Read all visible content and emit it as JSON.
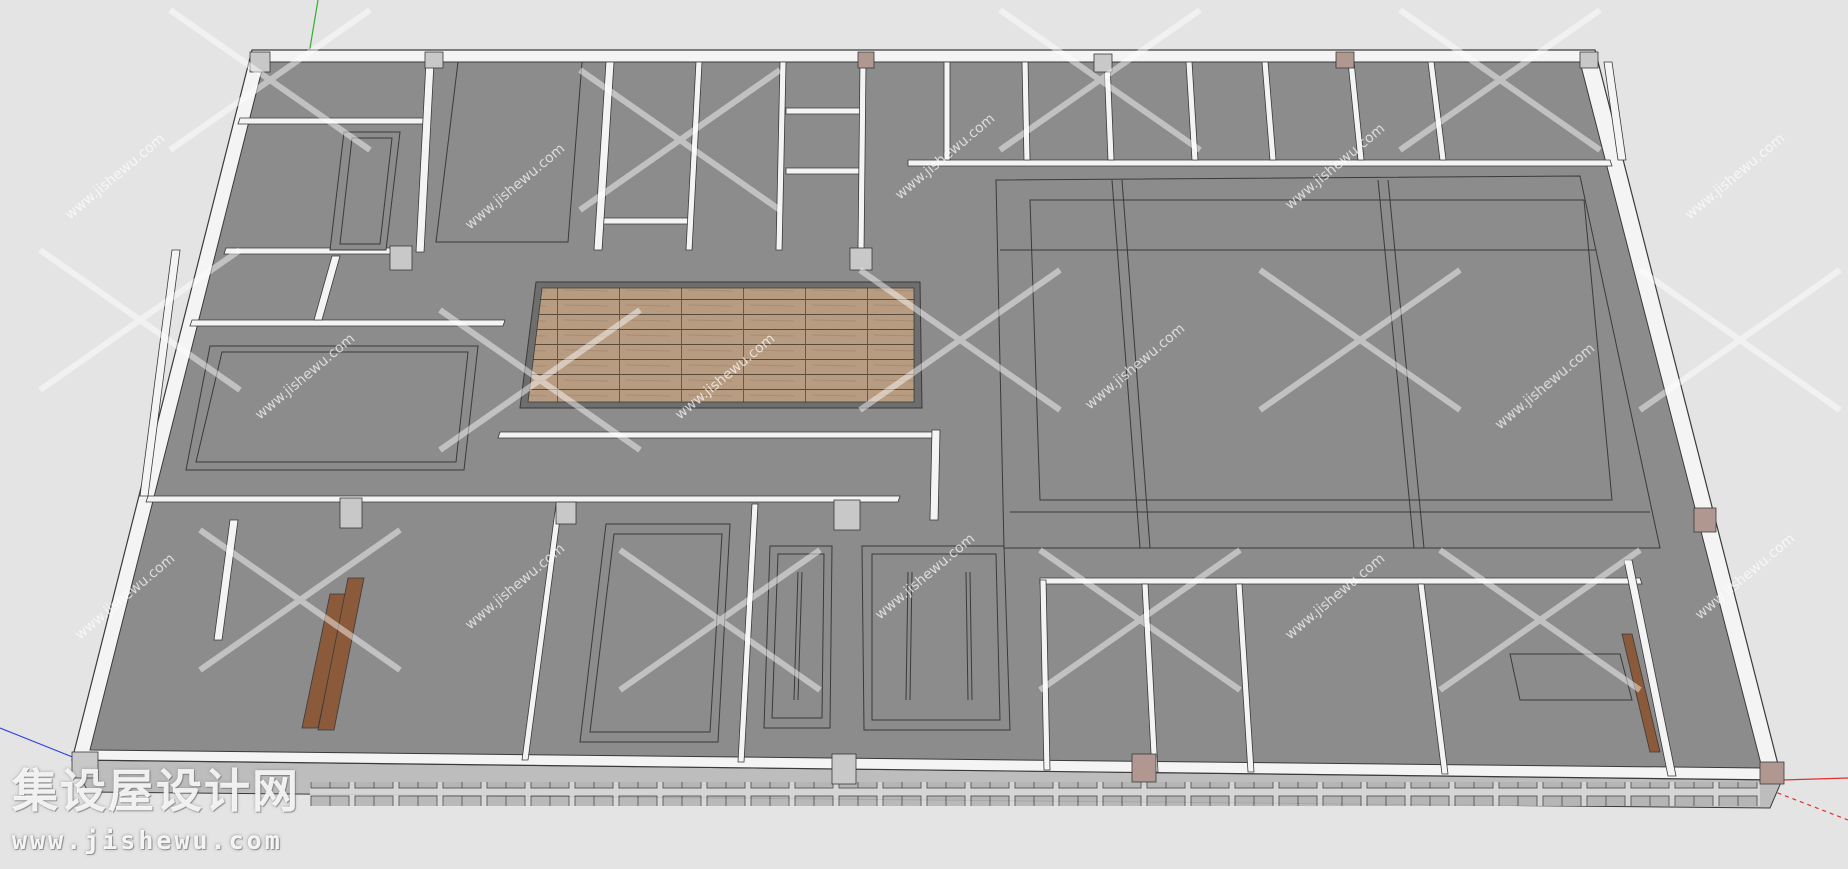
{
  "watermark": {
    "brand": "集设屋设计网",
    "url": "www.jishewu.com",
    "tile_text": "www.jishewu.com"
  },
  "colors": {
    "background": "#e4e4e4",
    "floor": "#8c8c8c",
    "wall": "#f4f4f4",
    "edge": "#3a3a3a",
    "wood": "#b49a80",
    "brick": "#a8908a",
    "axis_red": "#e03030",
    "axis_green": "#30b030",
    "axis_blue": "#3040e0"
  },
  "icons": {
    "watermark_logo": "cross-x-watermark-icon"
  }
}
